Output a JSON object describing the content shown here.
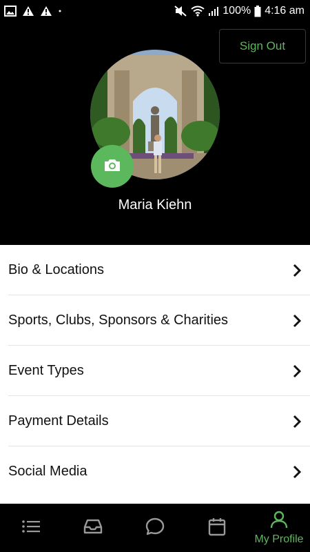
{
  "status_bar": {
    "battery": "100%",
    "time": "4:16 am"
  },
  "header": {
    "sign_out_label": "Sign Out",
    "profile_name": "Maria Kiehn"
  },
  "menu": {
    "items": [
      {
        "label": "Bio & Locations"
      },
      {
        "label": "Sports, Clubs, Sponsors & Charities"
      },
      {
        "label": "Event Types"
      },
      {
        "label": "Payment Details"
      },
      {
        "label": "Social Media"
      }
    ]
  },
  "bottom_nav": {
    "active_label": "My Profile",
    "icons": [
      "list-icon",
      "inbox-icon",
      "chat-icon",
      "calendar-icon",
      "profile-icon"
    ]
  },
  "colors": {
    "accent": "#5cb85c",
    "header_bg": "#000000",
    "list_bg": "#ffffff"
  }
}
